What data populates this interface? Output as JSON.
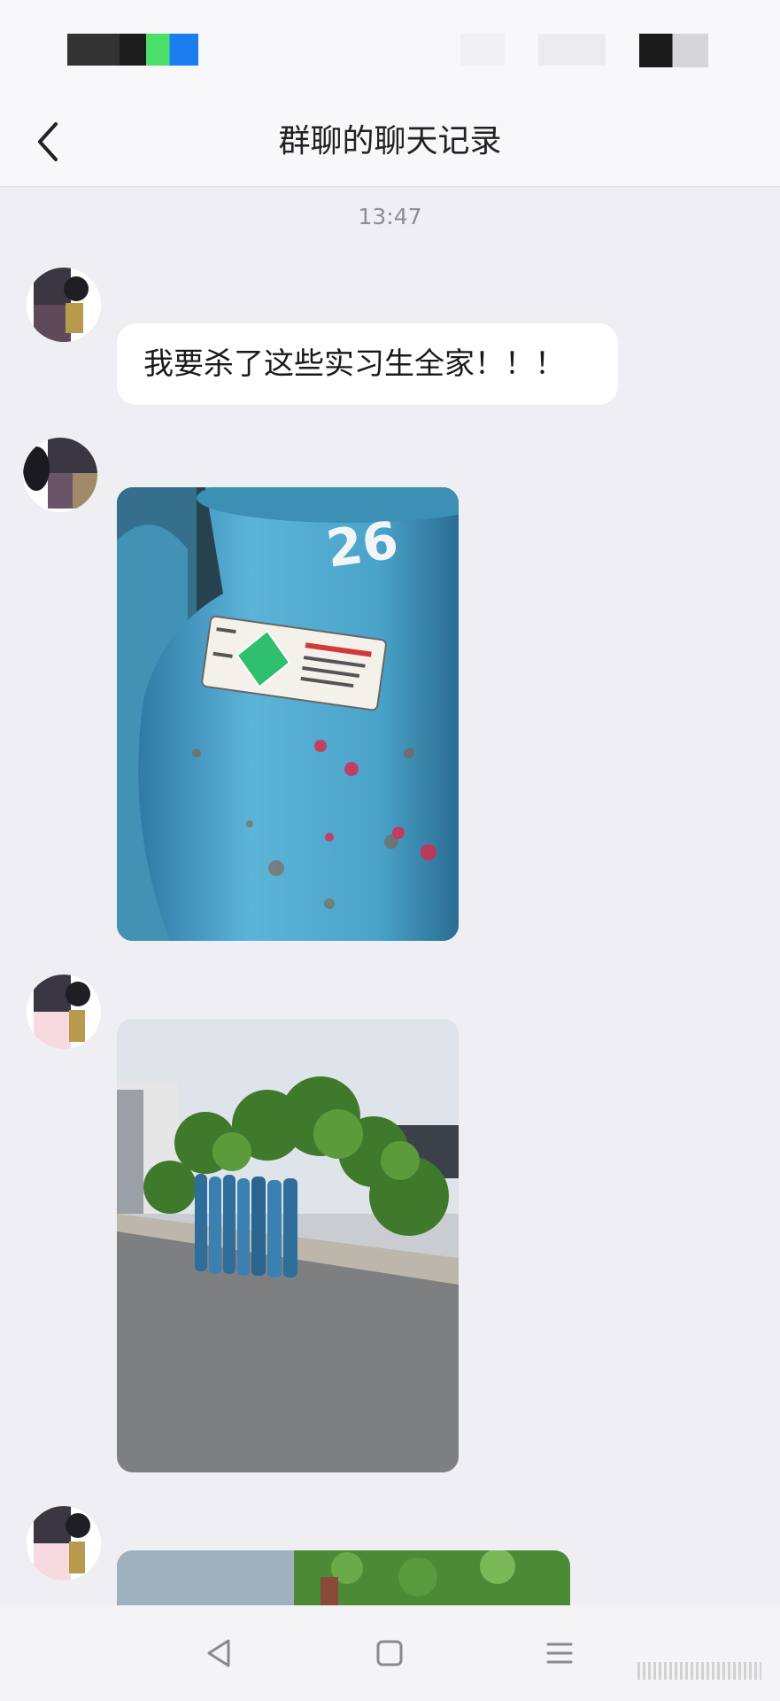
{
  "header": {
    "title": "群聊的聊天记录"
  },
  "chat": {
    "timestamp": "13:47",
    "text_message": "我要杀了这些实习生全家！！！"
  },
  "icons": {
    "back": "chevron-left-icon",
    "nav_back": "triangle-back-icon",
    "nav_home": "square-home-icon",
    "nav_menu": "hamburger-menu-icon"
  },
  "colors": {
    "background": "#efeff3",
    "bubble": "#ffffff",
    "header": "#f8f8fa"
  }
}
